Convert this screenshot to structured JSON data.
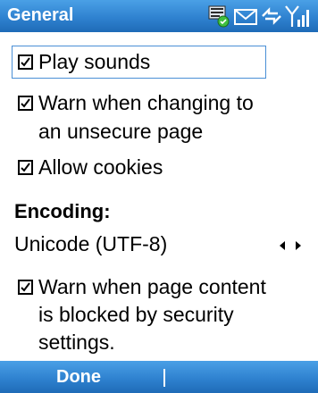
{
  "header": {
    "title": "General",
    "status_icons": [
      "device-sync-icon",
      "mail-icon",
      "data-connection-icon",
      "signal-strength-icon"
    ]
  },
  "options": [
    {
      "label": "Play sounds",
      "checked": true
    },
    {
      "label_line1": "Warn when changing to",
      "label_line2": "an unsecure page",
      "checked": true
    },
    {
      "label": "Allow cookies",
      "checked": true
    }
  ],
  "encoding": {
    "heading": "Encoding:",
    "value": "Unicode (UTF-8)"
  },
  "blocked_warning": {
    "line1": "Warn when page content",
    "line2": "is blocked by security",
    "line3": "settings.",
    "checked": true
  },
  "softkeys": {
    "left": "Done"
  },
  "colors": {
    "bar": "#2f82d0",
    "focus": "#4a8fd6"
  }
}
